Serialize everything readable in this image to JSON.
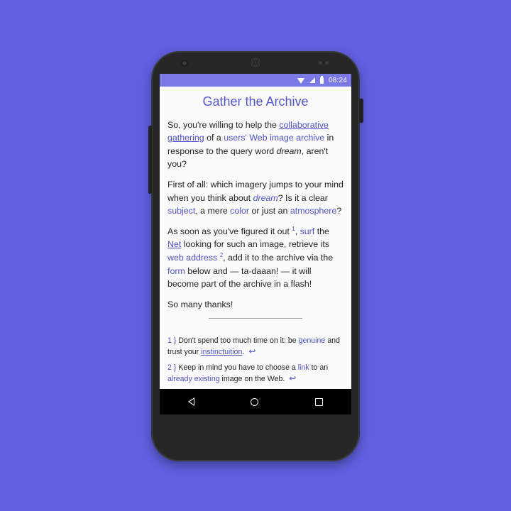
{
  "status_bar": {
    "time": "08:24",
    "icons": [
      "wifi-icon",
      "signal-icon",
      "battery-icon"
    ]
  },
  "page": {
    "title": "Gather the Archive",
    "p1": {
      "t1": "So, you're willing to help the ",
      "link1": "collaborative gathering",
      "t2": " of a ",
      "link2": "users' Web image archive",
      "t3": " in response to the query word ",
      "em": "dream",
      "t4": ", aren't you?"
    },
    "p2": {
      "t1": "First of all: which imagery jumps to your mind when you think about ",
      "em_link": "dream",
      "t2": "? Is it a clear ",
      "link1": "subject",
      "t3": ", a mere ",
      "link2": "color",
      "t4": " or just an ",
      "link3": "atmosphere",
      "t5": "?"
    },
    "p3": {
      "t1": "As soon as you've figured it out ",
      "sup1": "1",
      "t2": ", ",
      "link1": "surf",
      "t3": " the ",
      "link2": "Net",
      "t4": " looking for such an image, retrieve its ",
      "link3": "web address",
      "sup2": "2",
      "t5": ", add it to the archive via the ",
      "link4": "form",
      "t6": " below and — ta-daaan! — it will become part of the archive in a flash!"
    },
    "p4": "So many thanks!",
    "footnotes": [
      {
        "num": "1 }",
        "t1": " Don't spend too much time on it: be ",
        "link1": "genuine",
        "t2": " and trust your ",
        "link2": "instinctuition",
        "t3": "."
      },
      {
        "num": "2 }",
        "t1": " Keep in mind you have to choose a ",
        "link1": "link",
        "t2": " to an ",
        "link2": "already existing",
        "t3": " image on the Web."
      }
    ]
  },
  "nav_bar": {
    "buttons": [
      "back-icon",
      "home-icon",
      "recents-icon"
    ]
  },
  "colors": {
    "background": "#6060e0",
    "accent": "#5050c8",
    "status_bar": "#7a79e6",
    "phone_body": "#262626"
  }
}
